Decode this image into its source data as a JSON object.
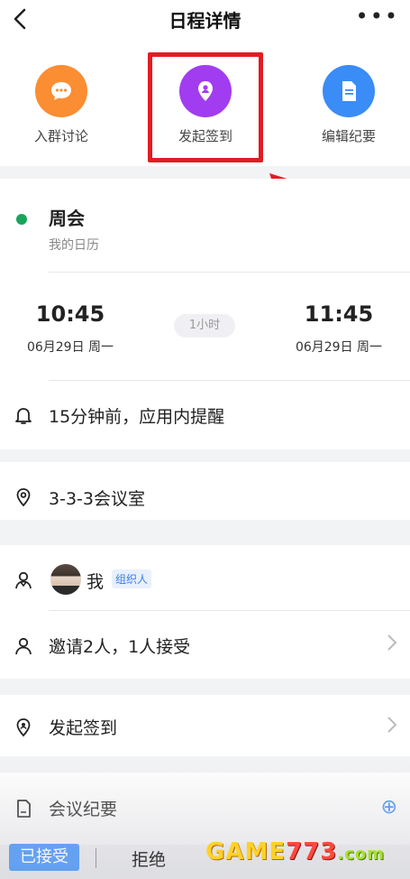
{
  "header": {
    "back_glyph": "‹",
    "title": "日程详情",
    "more_glyph": "•••"
  },
  "actions": [
    {
      "label": "入群讨论",
      "icon": "chat-bubble-icon",
      "color": "#fb8d33"
    },
    {
      "label": "发起签到",
      "icon": "location-checkin-icon",
      "color": "#a23cf0"
    },
    {
      "label": "编辑纪要",
      "icon": "document-icon",
      "color": "#3a8cf6"
    }
  ],
  "event": {
    "title": "周会",
    "calendar": "我的日历",
    "status_color": "#19a45c",
    "start_time": "10:45",
    "start_date": "06月29日 周一",
    "duration": "1小时",
    "end_time": "11:45",
    "end_date": "06月29日 周一",
    "reminder": "15分钟前，应用内提醒",
    "location": "3-3-3会议室"
  },
  "participants": {
    "organizer_name": "我",
    "organizer_tag": "组织人",
    "invite_summary": "邀请2人，1人接受"
  },
  "checkin": {
    "label": "发起签到"
  },
  "minutes": {
    "label": "会议纪要",
    "add_glyph": "⊕"
  },
  "footer": {
    "accepted_label": "已接受",
    "reject_label": "拒绝"
  },
  "watermark": {
    "part1": "GAME",
    "part2": "773",
    "part3": ".com"
  },
  "colors": {
    "highlight": "#e31b23",
    "accent": "#3a8cf6"
  }
}
